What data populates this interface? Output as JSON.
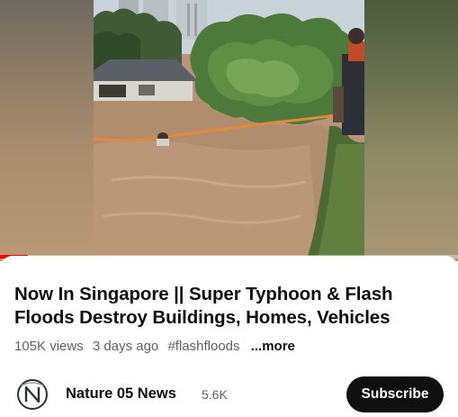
{
  "video": {
    "progress_percent": 6
  },
  "title": "Now In Singapore || Super Typhoon & Flash Floods Destroy Buildings, Homes, Vehicles",
  "meta": {
    "views": "105K views",
    "age": "3 days ago",
    "hashtag": "#flashfloods",
    "more": "...more"
  },
  "channel": {
    "name": "Nature 05 News",
    "subscribers": "5.6K",
    "subscribe_label": "Subscribe",
    "avatar_icon": "nature-05-news-logo"
  },
  "colors": {
    "progress": "#ff0000",
    "subscribe_bg": "#0f0f0f",
    "text_primary": "#0f0f0f",
    "text_secondary": "#606060"
  }
}
